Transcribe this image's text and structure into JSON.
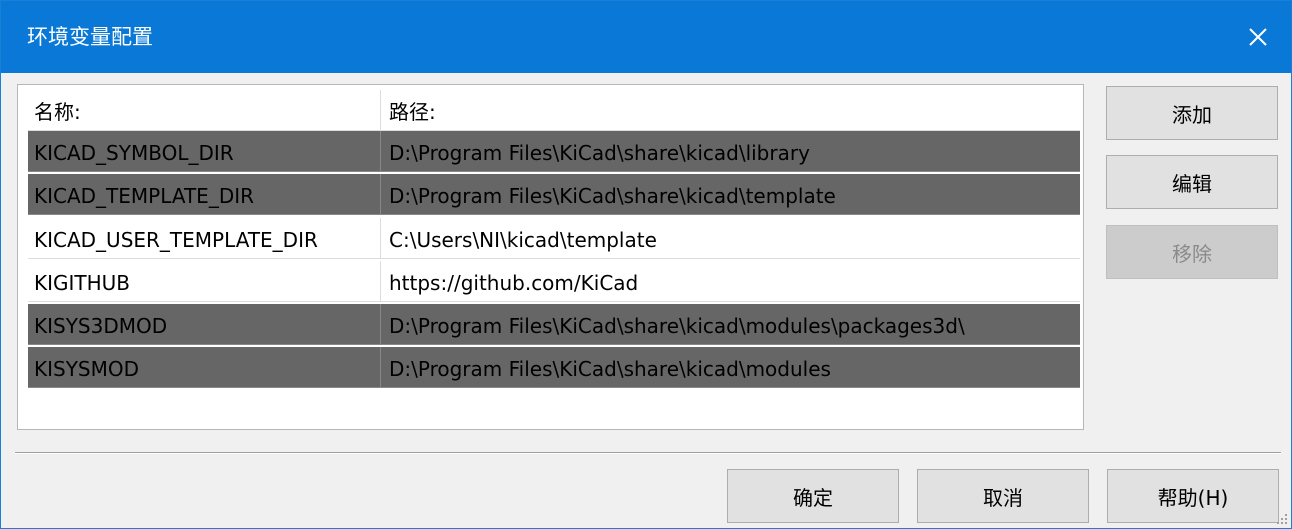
{
  "window": {
    "title": "环境变量配置"
  },
  "table": {
    "headers": [
      "名称:",
      "路径:"
    ],
    "rows": [
      {
        "name": "KICAD_SYMBOL_DIR",
        "path": "D:\\Program Files\\KiCad\\share\\kicad\\library",
        "selected": true
      },
      {
        "name": "KICAD_TEMPLATE_DIR",
        "path": "D:\\Program Files\\KiCad\\share\\kicad\\template",
        "selected": true
      },
      {
        "name": "KICAD_USER_TEMPLATE_DIR",
        "path": "C:\\Users\\NI\\kicad\\template",
        "selected": false
      },
      {
        "name": "KIGITHUB",
        "path": "https://github.com/KiCad",
        "selected": false
      },
      {
        "name": "KISYS3DMOD",
        "path": "D:\\Program Files\\KiCad\\share\\kicad\\modules\\packages3d\\",
        "selected": true
      },
      {
        "name": "KISYSMOD",
        "path": "D:\\Program Files\\KiCad\\share\\kicad\\modules",
        "selected": true
      }
    ]
  },
  "side_buttons": {
    "add": "添加",
    "edit": "编辑",
    "remove": "移除"
  },
  "footer_buttons": {
    "ok": "确定",
    "cancel": "取消",
    "help": "帮助(H)"
  },
  "icons": {
    "close": "close-icon",
    "resize": "resize-grip-icon"
  },
  "colors": {
    "titlebar": "#0a78d7",
    "selected_row": "#666666"
  }
}
